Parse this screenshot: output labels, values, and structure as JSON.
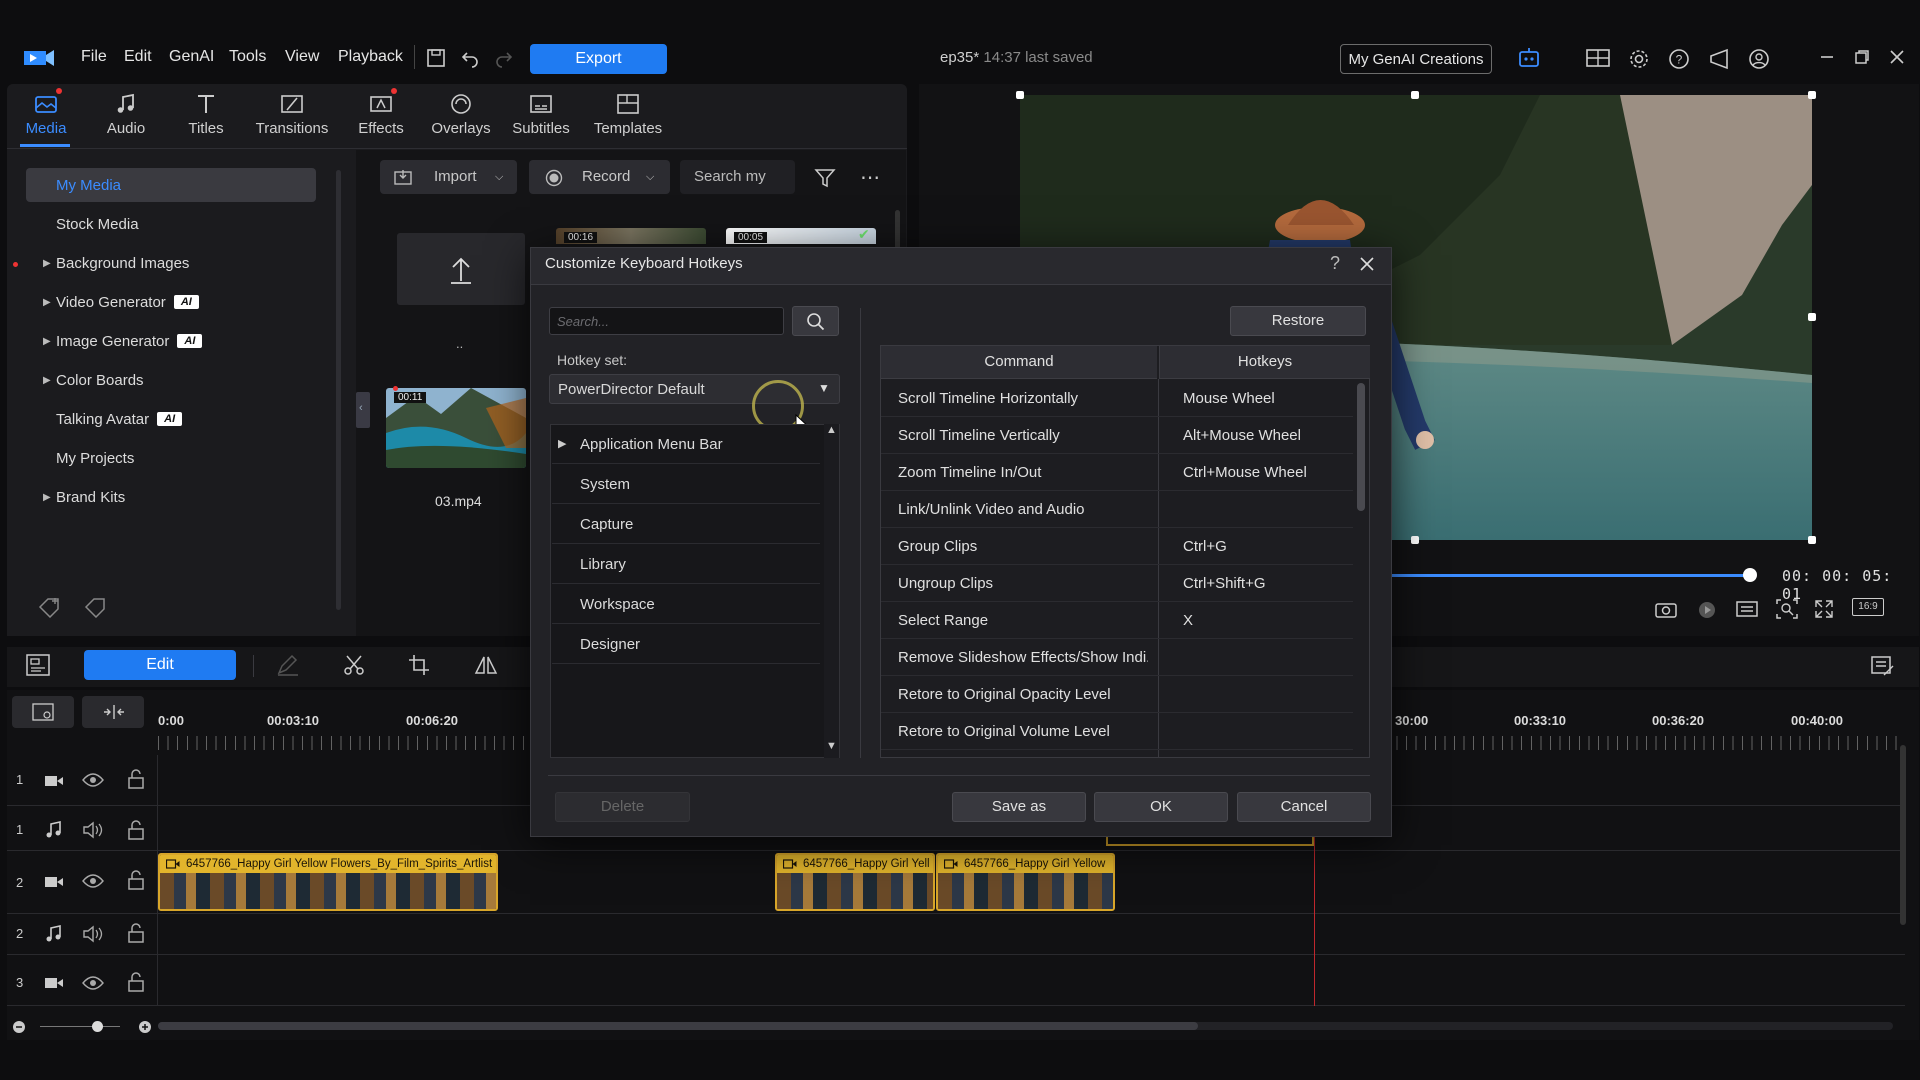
{
  "menu": [
    "File",
    "Edit",
    "GenAI",
    "Tools",
    "View",
    "Playback"
  ],
  "toolbar": {
    "export_label": "Export",
    "genai_creations_label": "My GenAI Creations"
  },
  "document": {
    "name": "ep35*",
    "saved_status": "14:37 last saved"
  },
  "library_tabs": [
    {
      "label": "Media",
      "icon": "media-icon",
      "active": true
    },
    {
      "label": "Audio",
      "icon": "music-note-icon"
    },
    {
      "label": "Titles",
      "icon": "title-t-icon"
    },
    {
      "label": "Transitions",
      "icon": "transition-icon"
    },
    {
      "label": "Effects",
      "icon": "effects-icon"
    },
    {
      "label": "Overlays",
      "icon": "overlay-icon"
    },
    {
      "label": "Subtitles",
      "icon": "subtitles-icon"
    },
    {
      "label": "Templates",
      "icon": "templates-icon"
    }
  ],
  "media_tree": [
    {
      "label": "My Media",
      "selected": true
    },
    {
      "label": "Stock Media"
    },
    {
      "label": "Background Images",
      "expandable": true
    },
    {
      "label": "Video Generator",
      "expandable": true,
      "ai": true
    },
    {
      "label": "Image Generator",
      "expandable": true,
      "ai": true
    },
    {
      "label": "Color Boards",
      "expandable": true
    },
    {
      "label": "Talking Avatar",
      "ai": true
    },
    {
      "label": "My Projects"
    },
    {
      "label": "Brand Kits",
      "expandable": true
    }
  ],
  "ai_badge": "AI",
  "media_toolbar": {
    "import_label": "Import",
    "record_label": "Record",
    "search_placeholder": "Search my"
  },
  "media_items": [
    {
      "name": "..",
      "duration": ""
    },
    {
      "name": "",
      "duration": "00:16"
    },
    {
      "name": "",
      "duration": "00:05"
    },
    {
      "name": "03.mp4",
      "duration": "00:11"
    }
  ],
  "preview": {
    "timecode": "00: 00: 05: 01",
    "aspect": "16:9"
  },
  "edit_bar": {
    "edit_label": "Edit"
  },
  "ruler_labels": [
    "0:00",
    "00:03:10",
    "00:06:20",
    "30:00",
    "00:33:10",
    "00:36:20",
    "00:40:00"
  ],
  "tracks": [
    {
      "num": "1",
      "type": "video"
    },
    {
      "num": "1",
      "type": "audio"
    },
    {
      "num": "2",
      "type": "video"
    },
    {
      "num": "2",
      "type": "audio"
    },
    {
      "num": "3",
      "type": "video"
    }
  ],
  "clips": [
    {
      "title": "6457766_Happy Girl Yellow Flowers_By_Film_Spirits_Artlist"
    },
    {
      "title": "6457766_Happy Girl Yell"
    },
    {
      "title": "6457766_Happy Girl Yellow"
    }
  ],
  "dialog": {
    "title": "Customize Keyboard Hotkeys",
    "search_placeholder": "Search...",
    "hotkey_set_label": "Hotkey set:",
    "hotkey_set_value": "PowerDirector Default",
    "restore_label": "Restore",
    "categories": [
      "Application Menu Bar",
      "System",
      "Capture",
      "Library",
      "Workspace",
      "Designer"
    ],
    "col_command": "Command",
    "col_hotkeys": "Hotkeys",
    "rows": [
      {
        "command": "Scroll Timeline Horizontally",
        "hotkey": "Mouse Wheel"
      },
      {
        "command": "Scroll Timeline Vertically",
        "hotkey": "Alt+Mouse Wheel"
      },
      {
        "command": "Zoom Timeline In/Out",
        "hotkey": "Ctrl+Mouse Wheel"
      },
      {
        "command": "Link/Unlink Video and Audio",
        "hotkey": ""
      },
      {
        "command": "Group Clips",
        "hotkey": "Ctrl+G"
      },
      {
        "command": "Ungroup Clips",
        "hotkey": "Ctrl+Shift+G"
      },
      {
        "command": "Select Range",
        "hotkey": "X"
      },
      {
        "command": "Remove Slideshow Effects/Show Indi...",
        "hotkey": ""
      },
      {
        "command": "Retore to Original Opacity Level",
        "hotkey": ""
      },
      {
        "command": "Retore to Original Volume Level",
        "hotkey": ""
      }
    ],
    "delete_label": "Delete",
    "save_as_label": "Save as",
    "ok_label": "OK",
    "cancel_label": "Cancel"
  }
}
